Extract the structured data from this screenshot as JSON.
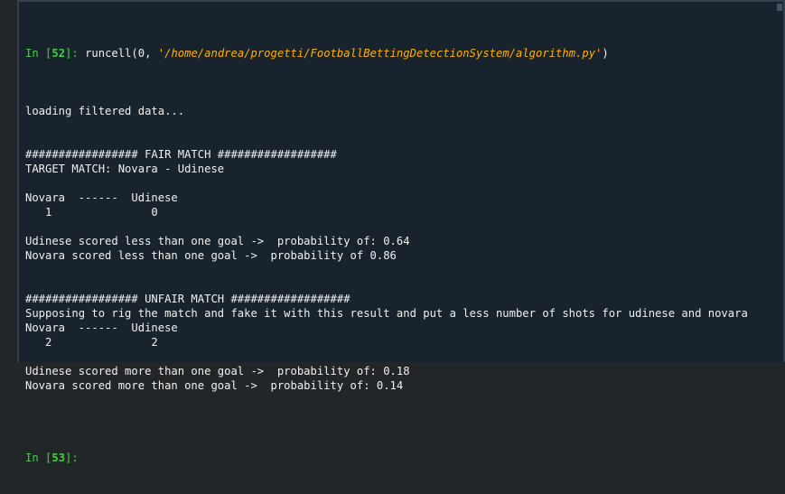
{
  "input_cell": {
    "prompt_prefix": "In [",
    "prompt_number": "52",
    "prompt_suffix": "]: ",
    "code_call": "runcell(0, ",
    "code_string": "'/home/andrea/progetti/FootballBettingDetectionSystem/algorithm.py'",
    "code_end": ")"
  },
  "output_lines": [
    "loading filtered data...",
    "",
    "",
    "################# FAIR MATCH ##################",
    "TARGET MATCH: Novara - Udinese",
    "",
    "Novara  ------  Udinese",
    "   1               0",
    "",
    "Udinese scored less than one goal ->  probability of: 0.64",
    "Novara scored less than one goal ->  probability of 0.86",
    "",
    "",
    "################# UNFAIR MATCH ##################",
    "Supposing to rig the match and fake it with this result and put a less number of shots for udinese and novara",
    "Novara  ------  Udinese",
    "   2               2",
    "",
    "Udinese scored more than one goal ->  probability of: 0.18",
    "Novara scored more than one goal ->  probability of: 0.14",
    ""
  ],
  "next_prompt": {
    "prefix": "In [",
    "number": "53",
    "suffix": "]:"
  },
  "colors": {
    "background": "#19232d",
    "prompt": "#3fd23f",
    "string": "#ffb000",
    "text": "#f0f0f0"
  }
}
